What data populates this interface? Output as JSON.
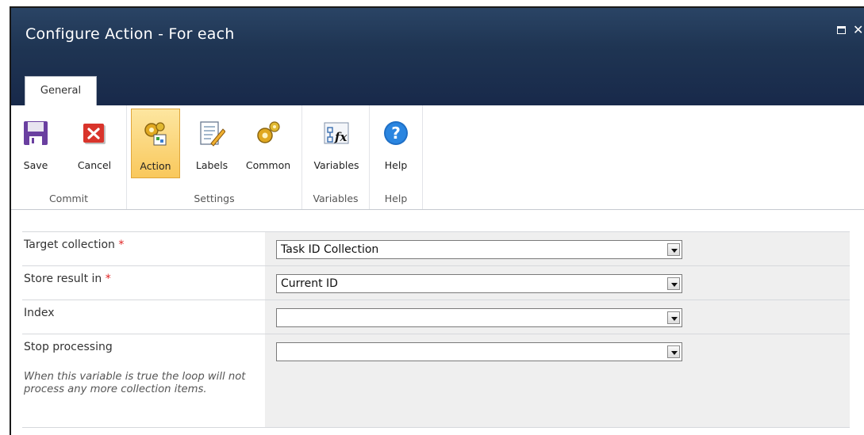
{
  "window": {
    "title": "Configure Action - For each"
  },
  "tabs": [
    {
      "label": "General"
    }
  ],
  "ribbon": {
    "groups": [
      {
        "label": "Commit",
        "buttons": [
          {
            "label": "Save",
            "icon": "save-disk-icon"
          },
          {
            "label": "Cancel",
            "icon": "cancel-x-icon"
          }
        ]
      },
      {
        "label": "Settings",
        "buttons": [
          {
            "label": "Action",
            "icon": "action-gears-icon"
          },
          {
            "label": "Labels",
            "icon": "labels-notepad-icon"
          },
          {
            "label": "Common",
            "icon": "common-gears-icon"
          }
        ]
      },
      {
        "label": "Variables",
        "buttons": [
          {
            "label": "Variables",
            "icon": "variables-fx-icon"
          }
        ]
      },
      {
        "label": "Help",
        "buttons": [
          {
            "label": "Help",
            "icon": "help-question-icon"
          }
        ]
      }
    ],
    "selected": "Action"
  },
  "form": {
    "rows": [
      {
        "label": "Target collection",
        "required": "*",
        "value": "Task ID Collection"
      },
      {
        "label": "Store result in",
        "required": "*",
        "value": "Current ID"
      },
      {
        "label": "Index",
        "value": ""
      },
      {
        "label": "Stop processing",
        "value": "",
        "hint": "When this variable is true the loop will not process any more collection items."
      }
    ]
  },
  "colors": {
    "titlebar": "#1f3553",
    "selected_button": "#f9c85c",
    "required_asterisk": "#e02020",
    "value_cell_bg": "#efefef"
  }
}
